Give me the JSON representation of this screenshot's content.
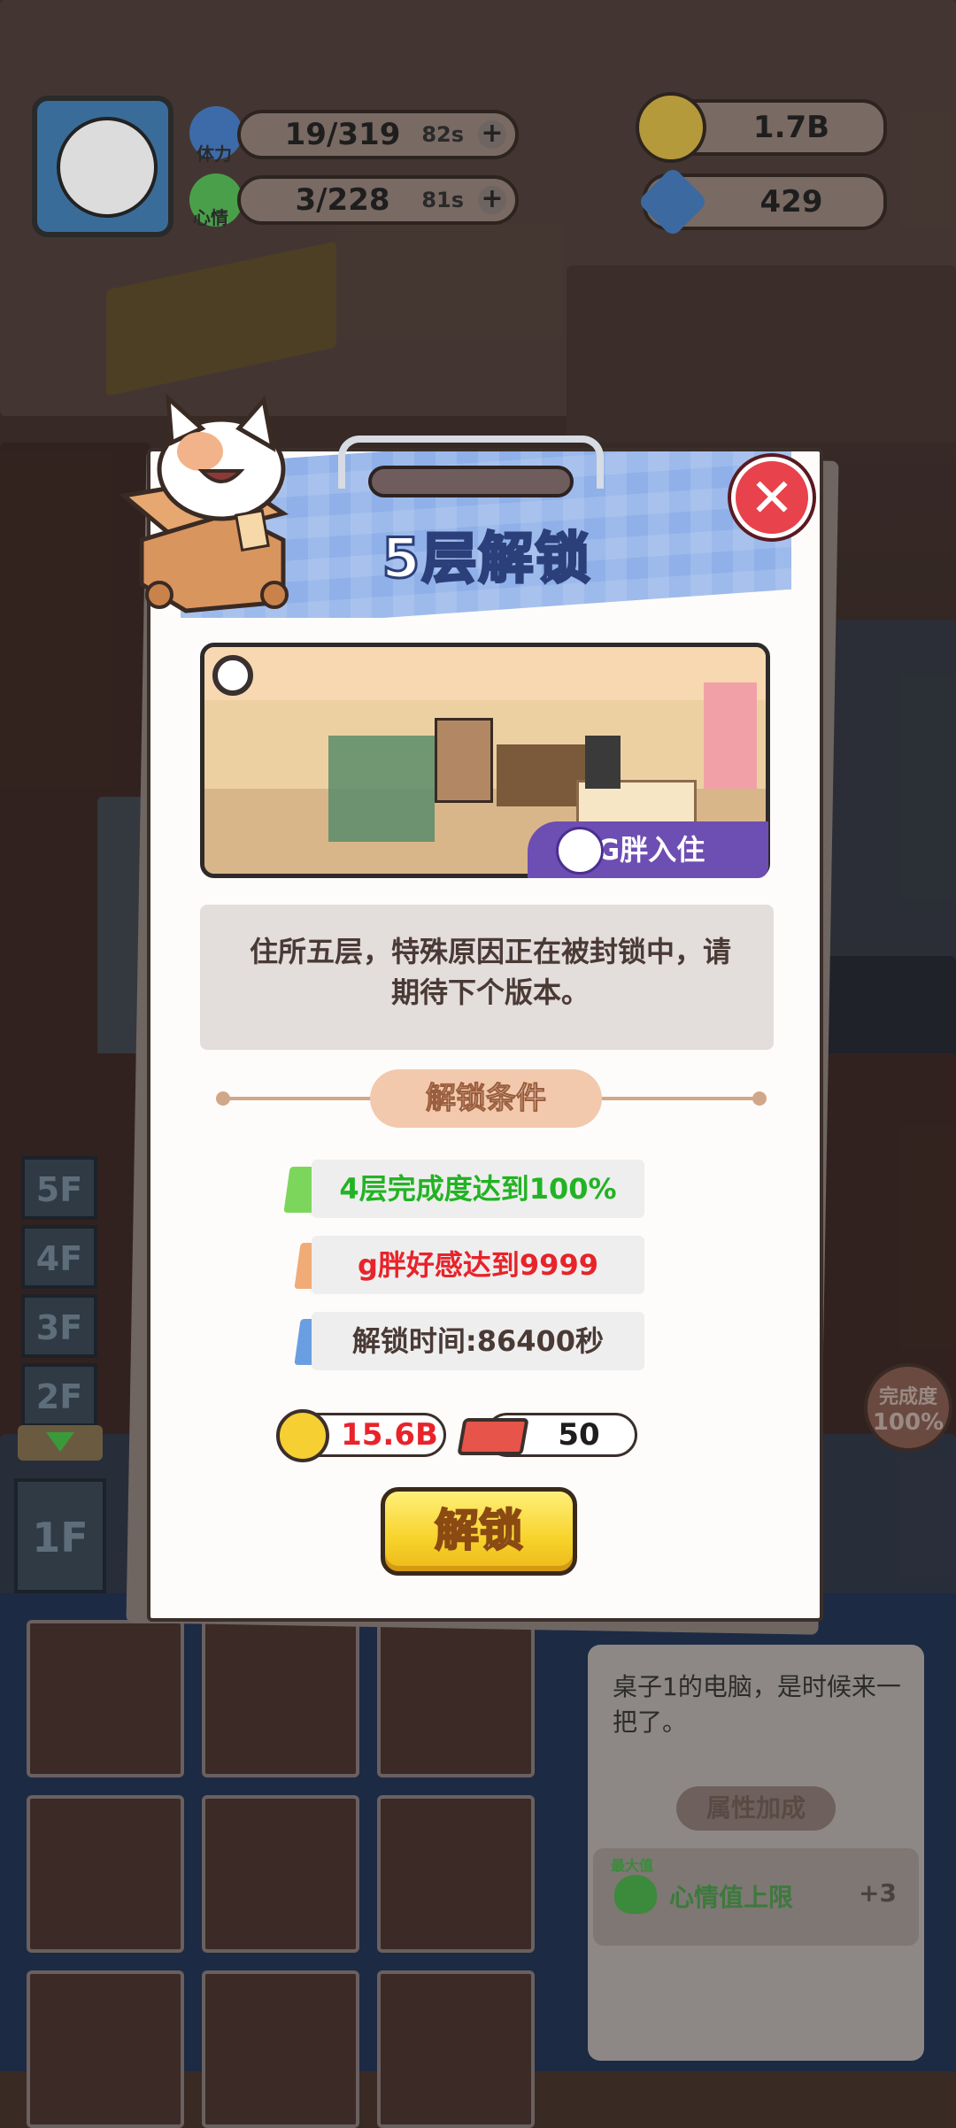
{
  "hud": {
    "stamina": {
      "label": "体力",
      "value": "19/319",
      "timer": "82s",
      "plus": "+"
    },
    "mood": {
      "label": "心情",
      "value": "3/228",
      "timer": "81s",
      "plus": "+"
    },
    "coins": "1.7B",
    "gems": "429"
  },
  "floors": [
    "5F",
    "4F",
    "3F",
    "2F",
    "1F"
  ],
  "side_badge": {
    "label": "完成度",
    "value": "100%"
  },
  "modal": {
    "title": "5层解锁",
    "close_symbol": "✕",
    "preview_badge": "G胖入住",
    "description": "住所五层，特殊原因正在被封锁中，请期待下个版本。",
    "conditions_title": "解锁条件",
    "conditions": [
      {
        "text": "4层完成度达到100%",
        "color": "#22b324",
        "brush": "#6fd14a"
      },
      {
        "text": "g胖好感达到9999",
        "color": "#e8232a",
        "brush": "#f0a267"
      },
      {
        "text": "解锁时间:86400秒",
        "color": "#4a3a35",
        "brush": "#5a93e0"
      }
    ],
    "cost_coins": "15.6B",
    "cost_bricks": "50",
    "unlock_button": "解锁"
  },
  "bottom_panel": {
    "item_desc": "桌子1的电脑，是时候来一把了。",
    "attr_title": "属性加成",
    "attr_label": "心情值上限",
    "attr_value": "+3",
    "attr_badge": "最大值"
  },
  "colors": {
    "accent_blue": "#8fb0e8",
    "close_red": "#e8424c",
    "button_yellow": "#f7d22a",
    "badge_purple": "#6d4eb2"
  }
}
